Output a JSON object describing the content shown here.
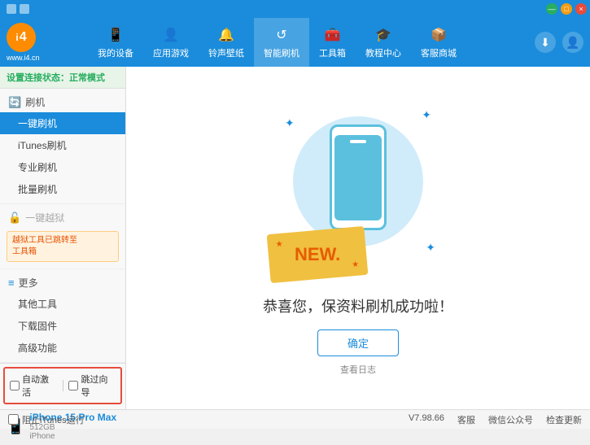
{
  "titlebar": {
    "icons": [
      "grid-icon",
      "minus-icon",
      "maximize-icon",
      "close-icon"
    ],
    "btn_min": "—",
    "btn_max": "□",
    "btn_close": "×"
  },
  "header": {
    "logo_circle": "i",
    "logo_url": "www.i4.cn",
    "nav_items": [
      {
        "id": "my-device",
        "icon": "📱",
        "label": "我的设备"
      },
      {
        "id": "app-games",
        "icon": "👤",
        "label": "应用游戏"
      },
      {
        "id": "ringtone",
        "icon": "🔔",
        "label": "铃声壁纸"
      },
      {
        "id": "smart-flash",
        "icon": "↺",
        "label": "智能刷机",
        "active": true
      },
      {
        "id": "toolbox",
        "icon": "🧰",
        "label": "工具箱"
      },
      {
        "id": "tutorial",
        "icon": "🎓",
        "label": "教程中心"
      },
      {
        "id": "service",
        "icon": "📦",
        "label": "客服商城"
      }
    ],
    "right_download": "⬇",
    "right_user": "👤"
  },
  "status": {
    "prefix": "设置连接状态：",
    "mode": "正常模式"
  },
  "sidebar": {
    "section_flash": {
      "icon": "🔄",
      "title": "刷机",
      "items": [
        {
          "id": "one-click-flash",
          "label": "一键刷机",
          "active": true
        },
        {
          "id": "itunes-flash",
          "label": "iTunes刷机"
        },
        {
          "id": "pro-flash",
          "label": "专业刷机"
        },
        {
          "id": "batch-flash",
          "label": "批量刷机"
        }
      ]
    },
    "section_jailbreak": {
      "icon": "🔓",
      "title": "一键越狱",
      "disabled": true,
      "notice": "越狱工具已跳转至\n工具箱"
    },
    "section_more": {
      "icon": "≡",
      "title": "更多",
      "items": [
        {
          "id": "other-tools",
          "label": "其他工具"
        },
        {
          "id": "download-firmware",
          "label": "下载固件"
        },
        {
          "id": "advanced",
          "label": "高级功能"
        }
      ]
    }
  },
  "content": {
    "success_text": "恭喜您，保资料刷机成功啦！",
    "confirm_btn": "确定",
    "log_link": "查看日志"
  },
  "device": {
    "checkbox_auto": "自动激活",
    "checkbox_guide": "跳过向导",
    "icon": "📱",
    "name": "iPhone 15 Pro Max",
    "storage": "512GB",
    "type": "iPhone"
  },
  "footer": {
    "stop_itunes": "阻止iTunes运行",
    "version": "V7.98.66",
    "feedback": "客服",
    "wechat": "微信公众号",
    "check_update": "检查更新"
  }
}
